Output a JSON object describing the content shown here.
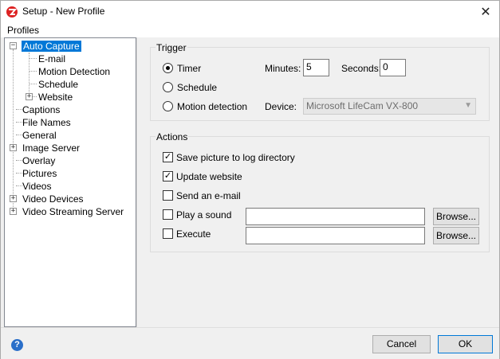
{
  "window": {
    "title": "Setup - New Profile"
  },
  "menu": {
    "profiles": "Profiles"
  },
  "tree": {
    "auto_capture": "Auto Capture",
    "email": "E-mail",
    "motion_detection": "Motion Detection",
    "schedule": "Schedule",
    "website": "Website",
    "captions": "Captions",
    "file_names": "File Names",
    "general": "General",
    "image_server": "Image Server",
    "overlay": "Overlay",
    "pictures": "Pictures",
    "videos": "Videos",
    "video_devices": "Video Devices",
    "video_streaming_server": "Video Streaming Server"
  },
  "trigger": {
    "label": "Trigger",
    "timer": "Timer",
    "schedule": "Schedule",
    "motion_detection": "Motion detection",
    "minutes_label": "Minutes:",
    "minutes_value": "5",
    "seconds_label": "Seconds:",
    "seconds_value": "0",
    "device_label": "Device:",
    "device_value": "Microsoft LifeCam VX-800"
  },
  "actions": {
    "label": "Actions",
    "save_picture": "Save picture to log directory",
    "update_website": "Update website",
    "send_email": "Send an e-mail",
    "play_sound": "Play a sound",
    "execute": "Execute",
    "browse": "Browse..."
  },
  "buttons": {
    "cancel": "Cancel",
    "ok": "OK"
  },
  "icons": {
    "help": "?",
    "close": "✕",
    "check": "✓",
    "arrow_down": "▼"
  }
}
